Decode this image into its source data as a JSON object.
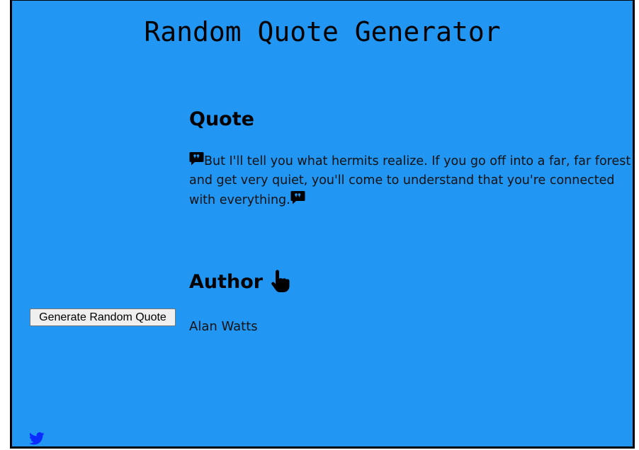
{
  "app": {
    "title": "Random Quote Generator"
  },
  "quote": {
    "heading": "Quote",
    "text": "But I'll tell you what hermits realize. If you go off into a far, far forest and get very quiet, you'll come to understand that you're connected with everything.",
    "open_icon": "quote-left-icon",
    "close_icon": "quote-right-icon"
  },
  "author": {
    "heading": "Author",
    "name": "Alan Watts",
    "icon": "hand-pointer-icon"
  },
  "controls": {
    "generate_label": "Generate Random Quote",
    "tweet_icon": "twitter-icon"
  },
  "colors": {
    "background": "#2196f3",
    "twitter": "#0a2cff",
    "text": "#000000"
  }
}
